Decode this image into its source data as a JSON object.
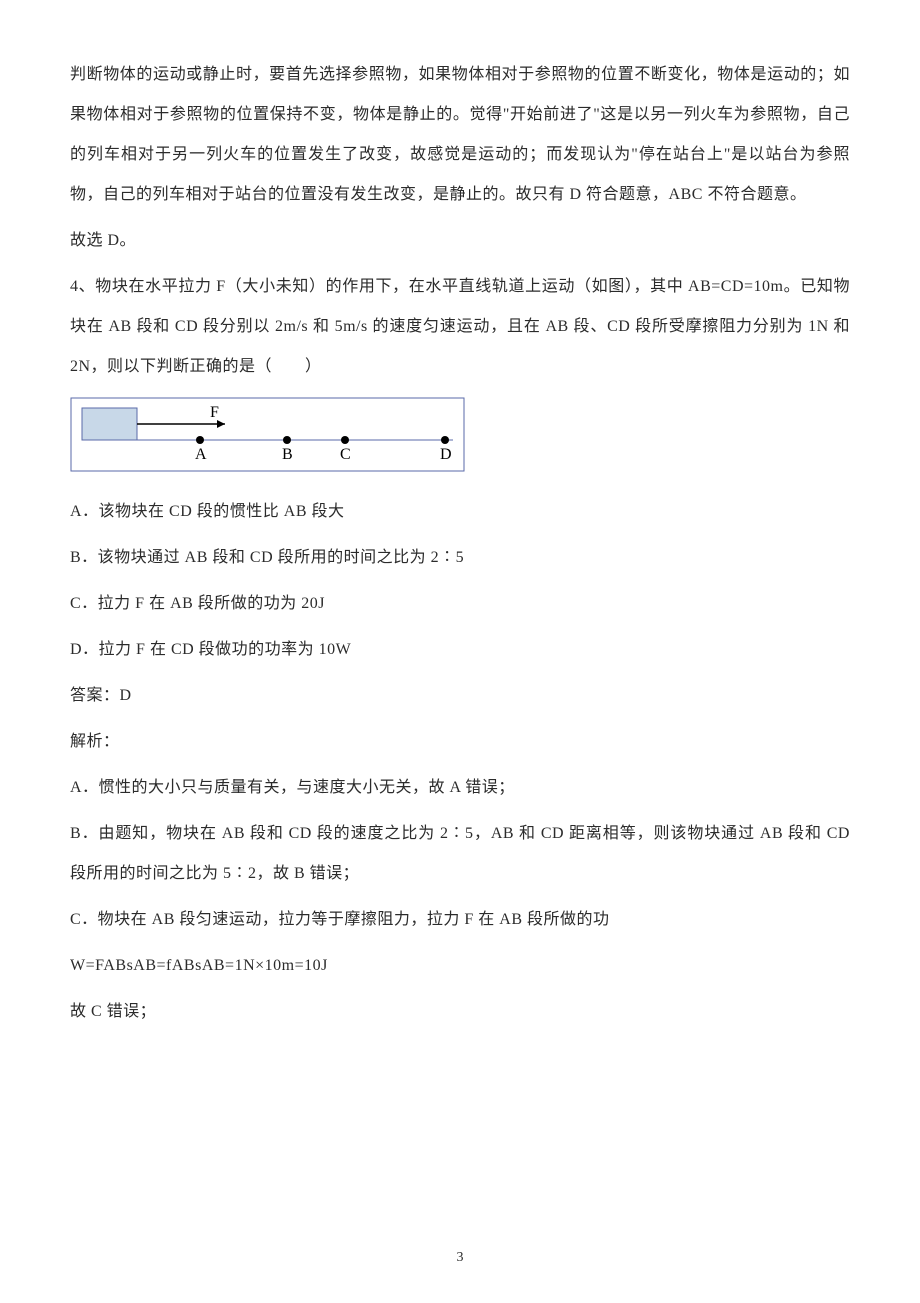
{
  "para1": "判断物体的运动或静止时，要首先选择参照物，如果物体相对于参照物的位置不断变化，物体是运动的；如果物体相对于参照物的位置保持不变，物体是静止的。觉得\"开始前进了\"这是以另一列火车为参照物，自己的列车相对于另一列火车的位置发生了改变，故感觉是运动的；而发现认为\"停在站台上\"是以站台为参照物，自己的列车相对于站台的位置没有发生改变，是静止的。故只有 D 符合题意，ABC 不符合题意。",
  "para2": "故选 D。",
  "q4_stem": "4、物块在水平拉力 F（大小未知）的作用下，在水平直线轨道上运动（如图），其中 AB=CD=10m。已知物块在 AB 段和 CD 段分别以 2m/s 和 5m/s 的速度匀速运动，且在 AB 段、CD 段所受摩擦阻力分别为 1N 和 2N，则以下判断正确的是（　　）",
  "figure": {
    "F": "F",
    "A": "A",
    "B": "B",
    "C": "C",
    "D": "D"
  },
  "optA": "A．该物块在 CD 段的惯性比 AB 段大",
  "optB": "B．该物块通过 AB 段和 CD 段所用的时间之比为 2∶5",
  "optC": "C．拉力 F 在 AB 段所做的功为 20J",
  "optD": "D．拉力 F 在 CD 段做功的功率为 10W",
  "answer": "答案：D",
  "analysis_label": "解析：",
  "expA": "A．惯性的大小只与质量有关，与速度大小无关，故 A 错误；",
  "expB": "B．由题知，物块在 AB 段和 CD 段的速度之比为 2∶5，AB 和 CD 距离相等，则该物块通过 AB 段和 CD 段所用的时间之比为 5∶2，故 B 错误；",
  "expC1": "C．物块在 AB 段匀速运动，拉力等于摩擦阻力，拉力 F 在 AB 段所做的功",
  "expC2": "W=FABsAB=fABsAB=1N×10m=10J",
  "expC3": "故 C 错误；",
  "page_number": "3"
}
